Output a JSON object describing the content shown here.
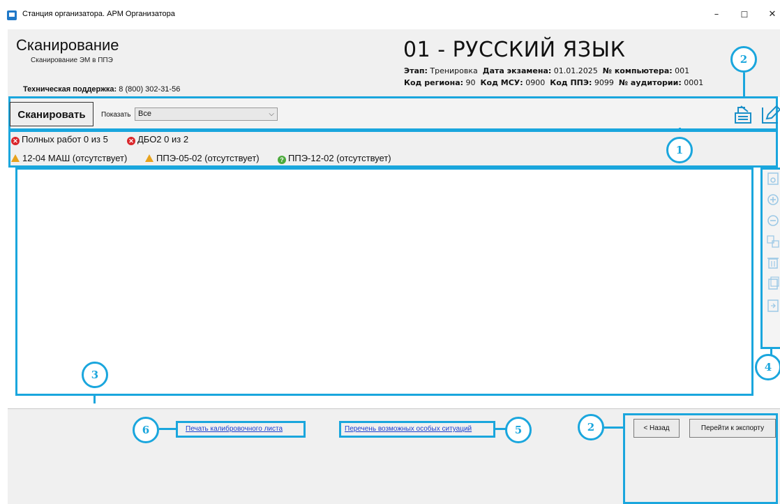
{
  "window": {
    "title": "Станция организатора. АРМ Организатора",
    "minimize_glyph": "–",
    "maximize_glyph": "☐",
    "close_glyph": "✕"
  },
  "header": {
    "page_title": "Сканирование",
    "page_subtitle": "Сканирование ЭМ в ППЭ",
    "support_label": "Техническая поддержка:",
    "support_phone": "8 (800) 302-31-56",
    "subject_title": "01 - РУССКИЙ ЯЗЫК",
    "meta_row1": [
      {
        "label": "Этап:",
        "value": "Тренировка"
      },
      {
        "label": "Дата экзамена:",
        "value": "01.01.2025"
      },
      {
        "label": "№ компьютера:",
        "value": "001"
      }
    ],
    "meta_row2": [
      {
        "label": "Код региона:",
        "value": "90"
      },
      {
        "label": "Код МСУ:",
        "value": "0900"
      },
      {
        "label": "Код ППЭ:",
        "value": "9099"
      },
      {
        "label": "№ аудитории:",
        "value": "0001"
      }
    ]
  },
  "toolbar": {
    "scan_button": "Сканировать",
    "show_label": "Показать",
    "show_value": "Все",
    "scanner_icon": "scanner-icon",
    "edit_icon": "pencil-icon"
  },
  "status": {
    "row1": [
      {
        "icon": "error-icon",
        "text": "Полных работ 0 из 5"
      },
      {
        "icon": "error-icon",
        "text": "ДБО2 0 из 2"
      }
    ],
    "row2": [
      {
        "icon": "warning-icon",
        "text": "12-04 МАШ (отсутствует)"
      },
      {
        "icon": "warning-icon",
        "text": "ППЭ-05-02 (отсутствует)"
      },
      {
        "icon": "ok-icon",
        "text": "ППЭ-12-02 (отсутствует)"
      }
    ]
  },
  "side_tools": [
    "view-icon",
    "zoom-in-icon",
    "zoom-out-icon",
    "checklist-icon",
    "trash-icon",
    "pages-icon",
    "export-page-icon"
  ],
  "footer": {
    "link_calibration": "Печать калибровочного листа",
    "link_special": "Перечень возможных особых ситуаций",
    "back_button": "< Назад",
    "export_button": "Перейти к экспорту"
  },
  "callouts": {
    "c1": "1",
    "c2_top": "2",
    "c2_bottom": "2",
    "c3": "3",
    "c4": "4",
    "c5": "5",
    "c6": "6"
  },
  "colors": {
    "accent": "#1aa6dd",
    "error": "#d9262b",
    "warning": "#e7a21c",
    "ok": "#4caa3c",
    "link": "#1a3fd0"
  }
}
